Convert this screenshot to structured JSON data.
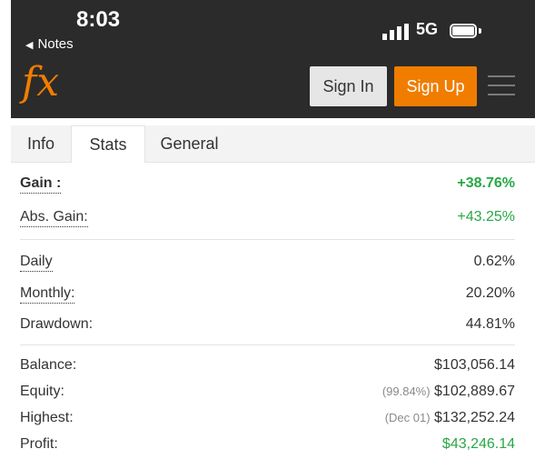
{
  "status_bar": {
    "time": "8:03",
    "back_label": "Notes",
    "network": "5G"
  },
  "header": {
    "logo": "fx",
    "sign_in": "Sign In",
    "sign_up": "Sign Up"
  },
  "tabs": [
    {
      "label": "Info"
    },
    {
      "label": "Stats"
    },
    {
      "label": "General"
    }
  ],
  "stats": {
    "gain": {
      "label": "Gain :",
      "value": "+38.76%"
    },
    "abs_gain": {
      "label": "Abs. Gain:",
      "value": "+43.25%"
    },
    "daily": {
      "label": "Daily",
      "value": "0.62%"
    },
    "monthly": {
      "label": "Monthly:",
      "value": "20.20%"
    },
    "drawdown": {
      "label": "Drawdown:",
      "value": "44.81%"
    },
    "balance": {
      "label": "Balance:",
      "value": "$103,056.14"
    },
    "equity": {
      "label": "Equity:",
      "note": "(99.84%)",
      "value": "$102,889.67"
    },
    "highest": {
      "label": "Highest:",
      "note": "(Dec 01)",
      "value": "$132,252.24"
    },
    "profit": {
      "label": "Profit:",
      "value": "$43,246.14"
    }
  },
  "colors": {
    "accent": "#f07d00",
    "positive": "#27a844",
    "header_bg": "#2b2b2b"
  }
}
